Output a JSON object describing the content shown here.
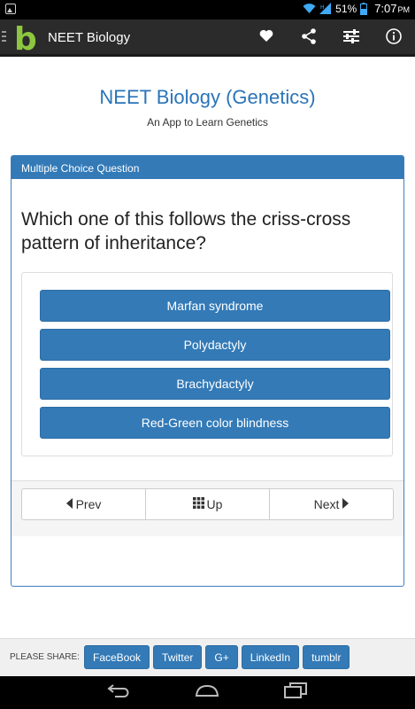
{
  "status_bar": {
    "battery_percent": "51%",
    "time": "7:07",
    "time_suffix": "PM"
  },
  "app_bar": {
    "title": "NEET Biology",
    "logo_letter": "b",
    "actions": [
      "heart-icon",
      "share-icon",
      "settings-sliders-icon",
      "info-icon"
    ]
  },
  "page": {
    "title": "NEET Biology (Genetics)",
    "subtitle": "An App to Learn Genetics"
  },
  "card": {
    "header": "Multiple Choice Question",
    "question": "Which one of this follows the criss-cross pattern of inheritance?",
    "options": [
      {
        "label": "Marfan syndrome"
      },
      {
        "label": "Polydactyly"
      },
      {
        "label": "Brachydactyly"
      },
      {
        "label": "Red-Green color blindness"
      }
    ],
    "nav": {
      "prev": "Prev",
      "up": "Up",
      "next": "Next"
    }
  },
  "share": {
    "label": "PLEASE SHARE:",
    "buttons": [
      "FaceBook",
      "Twitter",
      "G+",
      "LinkedIn",
      "tumblr"
    ]
  },
  "colors": {
    "accent": "#337ab7",
    "title": "#2a74b8",
    "logo": "#8dc63f",
    "appbar": "#2b2b2b"
  }
}
